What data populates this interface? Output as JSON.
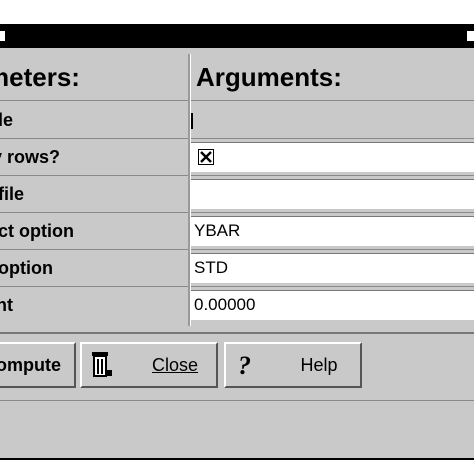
{
  "headers": {
    "parameters": "meters:",
    "arguments": "Arguments:"
  },
  "rows": [
    {
      "label": "le",
      "value": "",
      "type": "cursor"
    },
    {
      "label": "y rows?",
      "value": "",
      "type": "checkbox",
      "checked": true
    },
    {
      "label": "file",
      "value": "",
      "type": "text"
    },
    {
      "label": "ct option",
      "value": "YBAR",
      "type": "text"
    },
    {
      "label": "option",
      "value": "STD",
      "type": "text"
    },
    {
      "label": "nt",
      "value": "0.00000",
      "type": "text"
    }
  ],
  "buttons": {
    "compute": "ompute",
    "close": "Close",
    "help": "Help"
  },
  "icons": {
    "close": "trash-can-icon",
    "help": "question-mark-icon",
    "checkbox": "checkbox-checked-icon"
  }
}
